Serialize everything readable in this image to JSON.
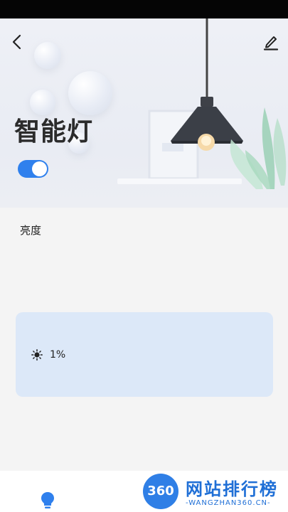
{
  "header": {
    "title": "智能灯",
    "back_icon": "chevron-left-icon",
    "edit_icon": "pencil-icon",
    "power_on": true,
    "accent_color": "#2f80ed"
  },
  "brightness": {
    "label": "亮度",
    "value": "1%",
    "icon": "sun-icon",
    "card_color": "#dce8f8"
  },
  "bottom_nav": {
    "icon": "lightbulb-icon"
  },
  "watermark": {
    "logo": "360",
    "title": "网站排行榜",
    "subtitle": "-WANGZHAN360.CN-"
  }
}
